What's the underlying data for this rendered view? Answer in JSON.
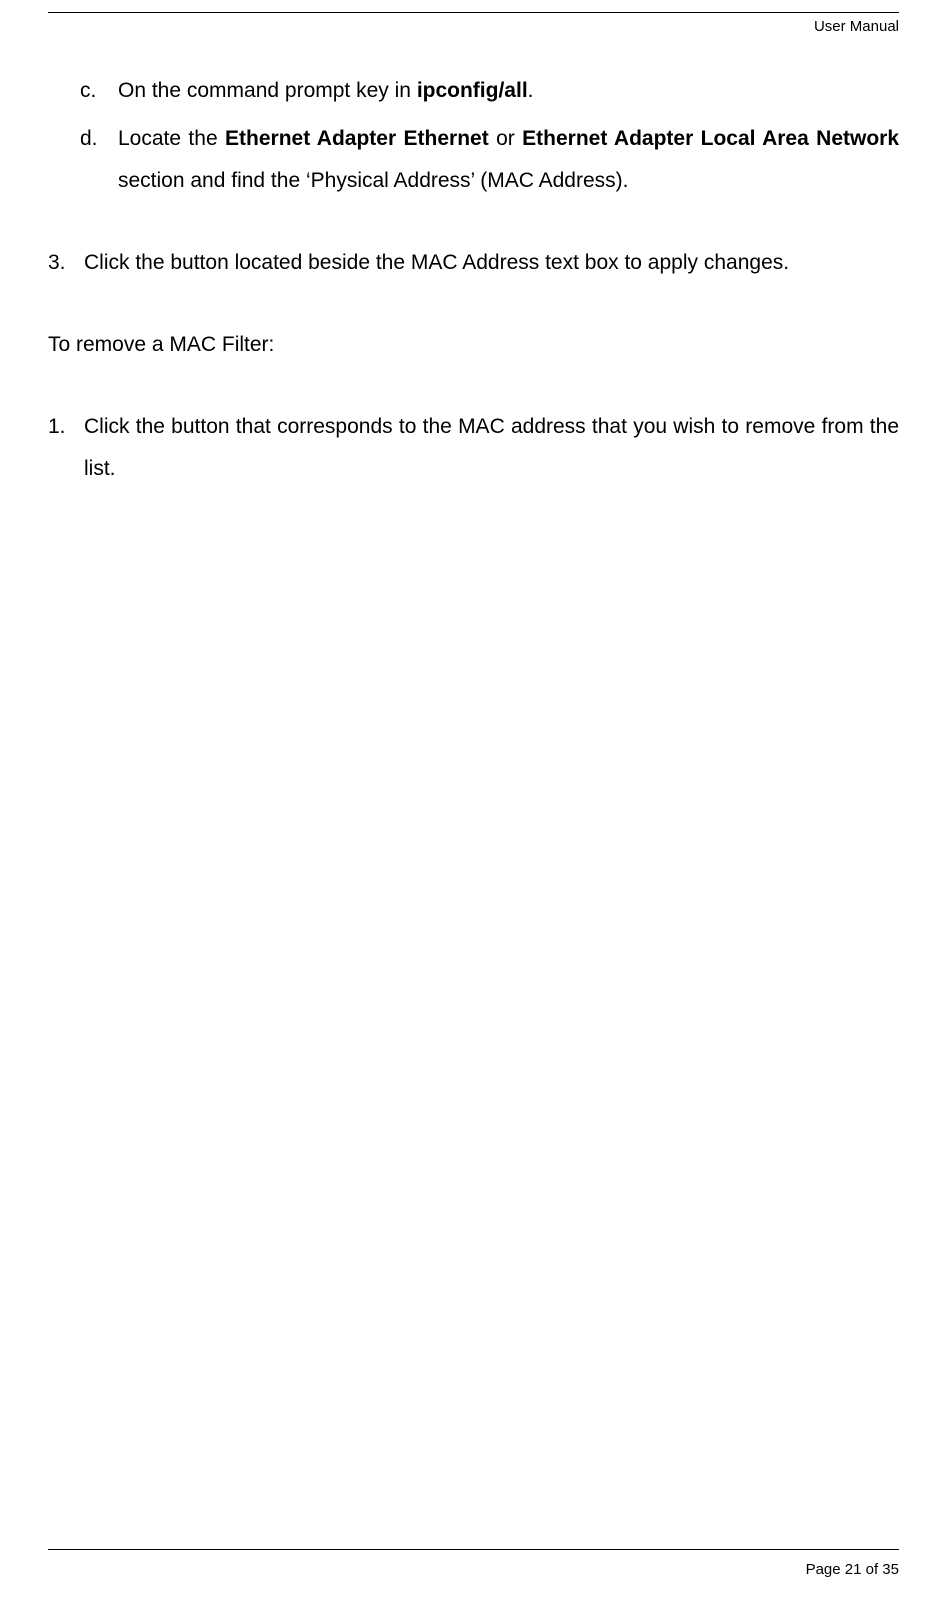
{
  "header": {
    "title": "User Manual"
  },
  "body": {
    "item_c": {
      "marker": "c.",
      "pre": "On the command prompt key in ",
      "bold": "ipconfig/all",
      "post": "."
    },
    "item_d": {
      "marker": "d.",
      "pre": "Locate the ",
      "bold1": "Ethernet Adapter Ethernet",
      "mid": " or ",
      "bold2": "Ethernet Adapter Local Area Network",
      "post": " section and find the ‘Physical Address’ (MAC Address)."
    },
    "item_3": {
      "marker": "3.",
      "text": "Click the button located beside the MAC Address text box to apply changes."
    },
    "remove_heading": "To remove a MAC Filter:",
    "item_1": {
      "marker": "1.",
      "text": "Click the button that corresponds to the MAC address that you wish to remove from the list."
    }
  },
  "footer": {
    "page_label": "Page 21 of 35"
  }
}
